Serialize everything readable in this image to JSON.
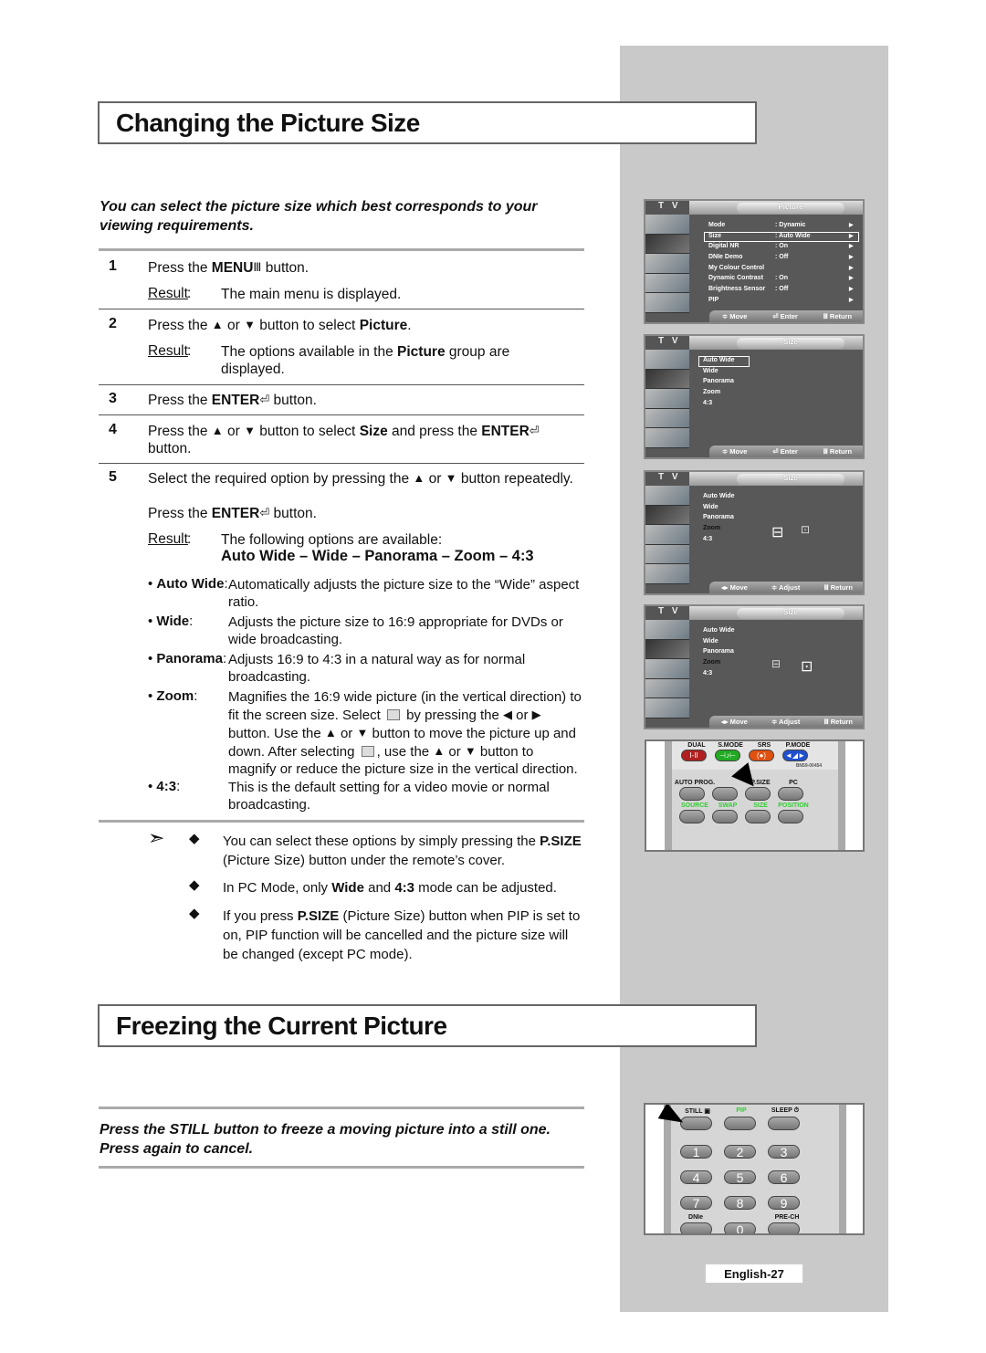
{
  "section1": {
    "title": "Changing the Picture Size",
    "intro": "You can select the picture size which best corresponds to your viewing requirements.",
    "steps": [
      {
        "num": "1",
        "lines": [
          [
            {
              "t": "Press the "
            },
            {
              "t": "MENU",
              "b": true
            },
            {
              "icon": "menu-icon"
            },
            {
              "t": " button."
            }
          ]
        ],
        "result_label": "Result",
        "result": [
          [
            {
              "t": ":"
            }
          ],
          [
            {
              "t": "The main menu is displayed."
            }
          ]
        ]
      },
      {
        "num": "2",
        "lines": [
          [
            {
              "t": "Press the "
            },
            {
              "icon": "up-arrow-icon"
            },
            {
              "t": " or "
            },
            {
              "icon": "down-arrow-icon"
            },
            {
              "t": " button to select "
            },
            {
              "t": "Picture",
              "b": true
            },
            {
              "t": "."
            }
          ]
        ],
        "result_label": "Result",
        "result": [
          [
            {
              "t": ":"
            }
          ],
          [
            {
              "t": "The options available in the "
            },
            {
              "t": "Picture",
              "b": true
            },
            {
              "t": " group are displayed."
            }
          ]
        ]
      },
      {
        "num": "3",
        "lines": [
          [
            {
              "t": "Press the "
            },
            {
              "t": "ENTER",
              "b": true
            },
            {
              "icon": "enter-icon"
            },
            {
              "t": " button."
            }
          ]
        ]
      },
      {
        "num": "4",
        "lines": [
          [
            {
              "t": "Press the "
            },
            {
              "icon": "up-arrow-icon"
            },
            {
              "t": " or "
            },
            {
              "icon": "down-arrow-icon"
            },
            {
              "t": " button to select "
            },
            {
              "t": "Size",
              "b": true
            },
            {
              "t": " and press the "
            },
            {
              "t": "ENTER",
              "b": true
            },
            {
              "icon": "enter-icon"
            },
            {
              "t": " button."
            }
          ]
        ]
      },
      {
        "num": "5",
        "lines": [
          [
            {
              "t": "Select the required option by pressing the "
            },
            {
              "icon": "up-arrow-icon"
            },
            {
              "t": " or "
            },
            {
              "icon": "down-arrow-icon"
            },
            {
              "t": " button repeatedly."
            }
          ],
          [
            {
              "t": "Press the "
            },
            {
              "t": "ENTER",
              "b": true
            },
            {
              "icon": "enter-icon"
            },
            {
              "t": " button."
            }
          ]
        ],
        "result_label": "Result",
        "result": [
          [
            {
              "t": ":"
            }
          ],
          [
            {
              "t": "The following options are available:"
            }
          ]
        ],
        "options": "Auto Wide – Wide – Panorama – Zoom – 4:3"
      }
    ],
    "bullets": [
      {
        "label": "Auto Wide",
        "sep": ":",
        "text": [
          {
            "t": "Automatically adjusts the picture size to the “Wide” aspect ratio."
          }
        ]
      },
      {
        "label": "Wide",
        "sep": ":",
        "text": [
          {
            "t": "Adjusts the picture size to 16:9 appropriate for DVDs or wide broadcasting."
          }
        ]
      },
      {
        "label": "Panorama",
        "sep": ":",
        "text": [
          {
            "t": "Adjusts 16:9 to 4:3 in a natural way as for normal broadcasting."
          }
        ]
      },
      {
        "label": "Zoom",
        "sep": ":",
        "text": [
          {
            "t": "Magnifies the 16:9 wide picture (in the vertical direction) to fit the screen size. Select "
          },
          {
            "icon": "zoom-position-icon"
          },
          {
            "t": " by pressing the "
          },
          {
            "icon": "left-arrow-icon"
          },
          {
            "t": " or "
          },
          {
            "icon": "right-arrow-icon"
          },
          {
            "t": " button. Use the "
          },
          {
            "icon": "up-arrow-icon"
          },
          {
            "t": " or "
          },
          {
            "icon": "down-arrow-icon"
          },
          {
            "t": " button to move the picture up and down. After selecting "
          },
          {
            "icon": "zoom-size-icon"
          },
          {
            "t": ", use the "
          },
          {
            "icon": "up-arrow-icon"
          },
          {
            "t": " or "
          },
          {
            "icon": "down-arrow-icon"
          },
          {
            "t": " button to magnify or reduce the picture size in the vertical direction."
          }
        ]
      },
      {
        "label": "4:3",
        "sep": ":",
        "text": [
          {
            "t": "This is the default setting for a video movie or normal broadcasting."
          }
        ]
      }
    ],
    "notes": [
      [
        {
          "t": "You can select these options by simply pressing the "
        },
        {
          "t": "P.SIZE",
          "b": true
        },
        {
          "t": " (Picture Size) button under the remote’s cover."
        }
      ],
      [
        {
          "t": "In PC Mode, only "
        },
        {
          "t": "Wide",
          "b": true
        },
        {
          "t": " and "
        },
        {
          "t": "4:3",
          "b": true
        },
        {
          "t": " mode can be adjusted."
        }
      ],
      [
        {
          "t": "If you press "
        },
        {
          "t": "P.SIZE",
          "b": true
        },
        {
          "t": " (Picture Size) button when PIP is set to on, PIP function will be cancelled and the picture size will be changed (except PC mode)."
        }
      ]
    ]
  },
  "section2": {
    "title": "Freezing the Current Picture",
    "intro": "Press the STILL button to freeze a moving picture into a still one. Press again to cancel."
  },
  "tv_menus": [
    {
      "tv": "T V",
      "title": "Picture",
      "items": [
        {
          "k": "Mode",
          "v": ": Dynamic",
          "a": true
        },
        {
          "k": "Size",
          "v": ": Auto Wide",
          "a": true,
          "sel": true
        },
        {
          "k": "Digital NR",
          "v": ": On",
          "a": true
        },
        {
          "k": "DNIe Demo",
          "v": ": Off",
          "a": true
        },
        {
          "k": "My Colour Control",
          "v": "",
          "a": true
        },
        {
          "k": "Dynamic Contrast",
          "v": ": On",
          "a": true
        },
        {
          "k": "Brightness Sensor",
          "v": ": Off",
          "a": true
        },
        {
          "k": "PIP",
          "v": "",
          "a": true
        }
      ],
      "footer": [
        "≑ Move",
        "⏎ Enter",
        "Ⅲ Return"
      ]
    },
    {
      "tv": "T V",
      "title": "Size",
      "items": [
        {
          "k": "Auto Wide",
          "sel": true
        },
        {
          "k": "Wide"
        },
        {
          "k": "Panorama"
        },
        {
          "k": "Zoom"
        },
        {
          "k": "4:3"
        }
      ],
      "footer": [
        "≑ Move",
        "⏎ Enter",
        "Ⅲ Return"
      ]
    },
    {
      "tv": "T V",
      "title": "Size",
      "items": [
        {
          "k": "Auto Wide"
        },
        {
          "k": "Wide"
        },
        {
          "k": "Panorama"
        },
        {
          "k": "Zoom",
          "dark": true
        },
        {
          "k": "4:3"
        }
      ],
      "footer": [
        "◂▸ Move",
        "≑ Adjust",
        "Ⅲ Return"
      ],
      "zoom_focus": "position"
    },
    {
      "tv": "T V",
      "title": "Size",
      "items": [
        {
          "k": "Auto Wide"
        },
        {
          "k": "Wide"
        },
        {
          "k": "Panorama"
        },
        {
          "k": "Zoom",
          "dark": true
        },
        {
          "k": "4:3"
        }
      ],
      "footer": [
        "◂▸ Move",
        "≑ Adjust",
        "Ⅲ Return"
      ],
      "zoom_focus": "size"
    }
  ],
  "remote1": {
    "top": [
      "DUAL",
      "S.MODE",
      "SRS",
      "P.MODE"
    ],
    "top_symbols": [
      "I-II",
      "⊣♪⊢",
      "(●)",
      "◄◢►"
    ],
    "top_colors": [
      "#b02020",
      "#22aa22",
      "#e05010",
      "#2050d0"
    ],
    "model": "BN59-00454",
    "row2": [
      "AUTO PROG.",
      "",
      "P.SIZE",
      "PC"
    ],
    "row3": [
      "SOURCE",
      "SWAP",
      "SIZE",
      "POSITION"
    ]
  },
  "remote2": {
    "top": [
      "STILL ▣",
      "PIP",
      "SLEEP ⏱"
    ],
    "digits": [
      "1",
      "2",
      "3",
      "4",
      "5",
      "6",
      "7",
      "8",
      "9"
    ],
    "dnie": "DNIe",
    "zero": "0",
    "prech": "PRE-CH"
  },
  "page_label": "English-27",
  "icons": {
    "menu-icon": "Ⅲ",
    "enter-icon": "⏎",
    "up-arrow-icon": "▲",
    "down-arrow-icon": "▼",
    "left-arrow-icon": "◀",
    "right-arrow-icon": "▶",
    "note-icon": "➣",
    "bullet-icon": "◆"
  }
}
